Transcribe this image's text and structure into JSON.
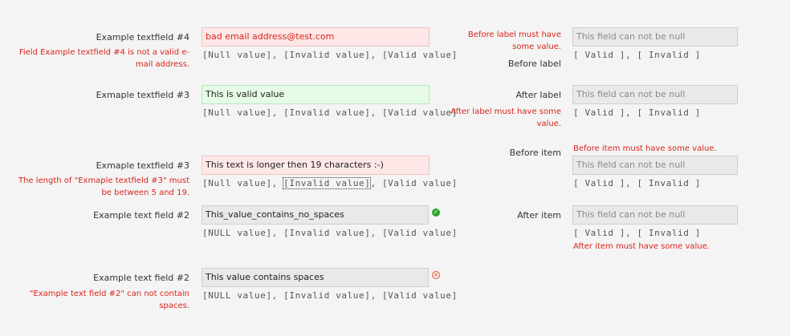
{
  "left": {
    "rows": [
      {
        "label": "Example textfield #4",
        "value": "bad email address@test.com",
        "error": [
          "Field Example textfield #4 is not a valid e-",
          "mail address."
        ],
        "links": [
          "[Null value]",
          "[Invalid value]",
          "[Valid value]"
        ]
      },
      {
        "label": "Exmaple textfield #3",
        "value": "This is valid value",
        "links": [
          "[Null value]",
          "[Invalid value]",
          "[Valid value]"
        ]
      },
      {
        "label": "Exmaple textfield #3",
        "value": "This text is longer then 19 characters :-)",
        "error": [
          "The length of \"Exmaple textfield #3\" must",
          "be between 5 and 19."
        ],
        "links": [
          "[Null value]",
          "[Invalid value]",
          "[Valid value]"
        ]
      },
      {
        "label": "Example text field #2",
        "value": "This_value_contains_no_spaces",
        "links": [
          "[NULL value]",
          "[Invalid value]",
          "[Valid value]"
        ]
      },
      {
        "label": "Example text field #2",
        "value": "This value contains spaces",
        "error": [
          "\"Example text field #2\" can not contain",
          "spaces."
        ],
        "links": [
          "[NULL value]",
          "[Invalid value]",
          "[Valid value]"
        ]
      }
    ]
  },
  "right": {
    "placeholder": "This field can not be null",
    "links": [
      "[ Valid ]",
      "[ Invalid ]"
    ],
    "before_label": {
      "error": [
        "Before label must have",
        "some value."
      ],
      "label": "Before label"
    },
    "after_label": {
      "label": "After label",
      "error": [
        "After label must have some",
        "value."
      ]
    },
    "before_item": {
      "label": "Before item",
      "error": "Before item must have some value."
    },
    "after_item": {
      "label": "After item",
      "error": "After item must have some value."
    }
  }
}
